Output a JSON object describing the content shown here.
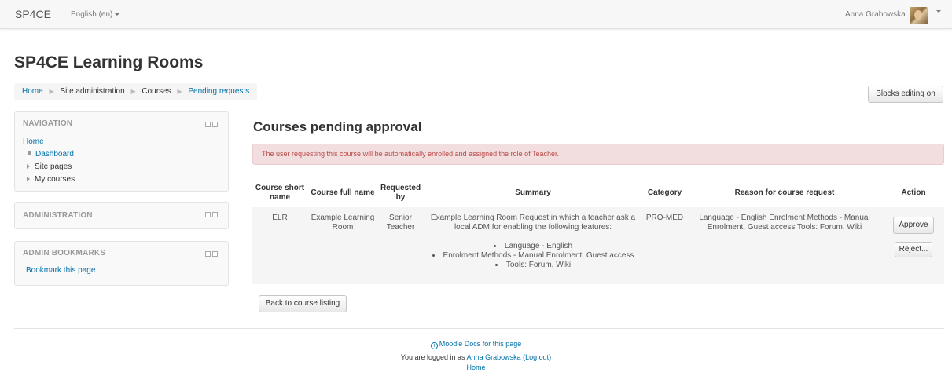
{
  "navbar": {
    "brand": "SP4CE",
    "language": "English (en)",
    "user_name": "Anna Grabowska"
  },
  "page": {
    "title": "SP4CE Learning Rooms",
    "blocks_editing_button": "Blocks editing on"
  },
  "breadcrumb": [
    {
      "label": "Home"
    },
    {
      "label": "Site administration"
    },
    {
      "label": "Courses"
    },
    {
      "label": "Pending requests"
    }
  ],
  "blocks": {
    "navigation": {
      "title": "NAVIGATION",
      "home": "Home",
      "items": [
        {
          "label": "Dashboard"
        },
        {
          "label": "Site pages"
        },
        {
          "label": "My courses"
        }
      ]
    },
    "administration": {
      "title": "ADMINISTRATION"
    },
    "bookmarks": {
      "title": "ADMIN BOOKMARKS",
      "link": "Bookmark this page"
    }
  },
  "main": {
    "heading": "Courses pending approval",
    "alert": "The user requesting this course will be automatically enrolled and assigned the role of Teacher.",
    "table": {
      "headers": [
        "Course short name",
        "Course full name",
        "Requested by",
        "Summary",
        "Category",
        "Reason for course request",
        "Action"
      ],
      "row": {
        "short_name": "ELR",
        "full_name": "Example Learning Room",
        "requested_by": "Senior Teacher",
        "summary_intro": "Example Learning Room Request in which a teacher ask a local ADM for enabling the following features:",
        "summary_items": [
          "Language - English",
          "Enrolment Methods - Manual Enrolment, Guest access",
          "Tools: Forum, Wiki"
        ],
        "category": "PRO-MED",
        "reason": "Language - English Enrolment Methods - Manual Enrolment, Guest access Tools: Forum, Wiki",
        "approve_label": "Approve",
        "reject_label": "Reject..."
      }
    },
    "back_button": "Back to course listing"
  },
  "footer": {
    "docs_link": "Moodle Docs for this page",
    "logged_in_prefix": "You are logged in as",
    "user_link": "Anna Grabowska",
    "logout": "(Log out)",
    "home": "Home"
  }
}
